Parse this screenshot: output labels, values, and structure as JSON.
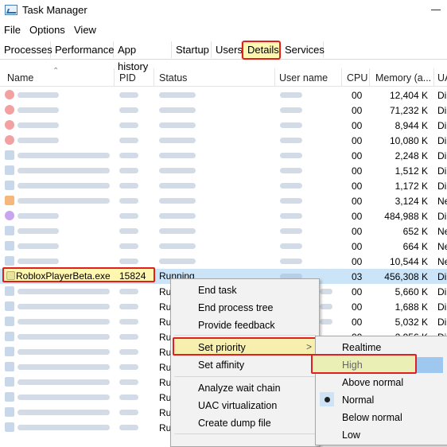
{
  "window": {
    "title": "Task Manager"
  },
  "menu": [
    "File",
    "Options",
    "View"
  ],
  "tabs": [
    "Processes",
    "Performance",
    "App history",
    "Startup",
    "Users",
    "Details",
    "Services"
  ],
  "active_tab": "Details",
  "columns": [
    "Name",
    "PID",
    "Status",
    "User name",
    "CPU",
    "Memory (a...",
    "UA"
  ],
  "rows": [
    {
      "cpu": "00",
      "mem": "12,404 K",
      "ua": "Di"
    },
    {
      "cpu": "00",
      "mem": "71,232 K",
      "ua": "Di"
    },
    {
      "cpu": "00",
      "mem": "8,944 K",
      "ua": "Di"
    },
    {
      "cpu": "00",
      "mem": "10,080 K",
      "ua": "Di"
    },
    {
      "cpu": "00",
      "mem": "2,248 K",
      "ua": "Di"
    },
    {
      "cpu": "00",
      "mem": "1,512 K",
      "ua": "Di"
    },
    {
      "cpu": "00",
      "mem": "1,172 K",
      "ua": "Di"
    },
    {
      "cpu": "00",
      "mem": "3,124 K",
      "ua": "Ne"
    },
    {
      "cpu": "00",
      "mem": "484,988 K",
      "ua": "Di"
    },
    {
      "cpu": "00",
      "mem": "652 K",
      "ua": "Ne"
    },
    {
      "cpu": "00",
      "mem": "664 K",
      "ua": "Ne"
    },
    {
      "cpu": "00",
      "mem": "10,544 K",
      "ua": "Ne"
    },
    {
      "name": "RobloxPlayerBeta.exe",
      "pid": "15824",
      "status": "Running",
      "cpu": "03",
      "mem": "456,308 K",
      "ua": "Di"
    },
    {
      "status": "Ru",
      "cpu": "00",
      "mem": "5,660 K",
      "ua": "Di"
    },
    {
      "status": "Ru",
      "cpu": "00",
      "mem": "1,688 K",
      "ua": "Di"
    },
    {
      "status": "Ru",
      "cpu": "00",
      "mem": "5,032 K",
      "ua": "Di"
    },
    {
      "status": "Ru",
      "cpu": "00",
      "mem": "2,956 K",
      "ua": "Di"
    },
    {
      "status": "Ru"
    },
    {
      "status": "Ru"
    },
    {
      "status": "Ru"
    },
    {
      "status": "Ru"
    },
    {
      "status": "Ru"
    },
    {
      "status": "Ru"
    }
  ],
  "context_menu": {
    "items": [
      "End task",
      "End process tree",
      "Provide feedback",
      "Set priority",
      "Set affinity",
      "Analyze wait chain",
      "UAC virtualization",
      "Create dump file"
    ],
    "submenu_arrow": ">"
  },
  "priority_menu": {
    "items": [
      "Realtime",
      "High",
      "Above normal",
      "Normal",
      "Below normal",
      "Low"
    ],
    "current": "Normal"
  }
}
